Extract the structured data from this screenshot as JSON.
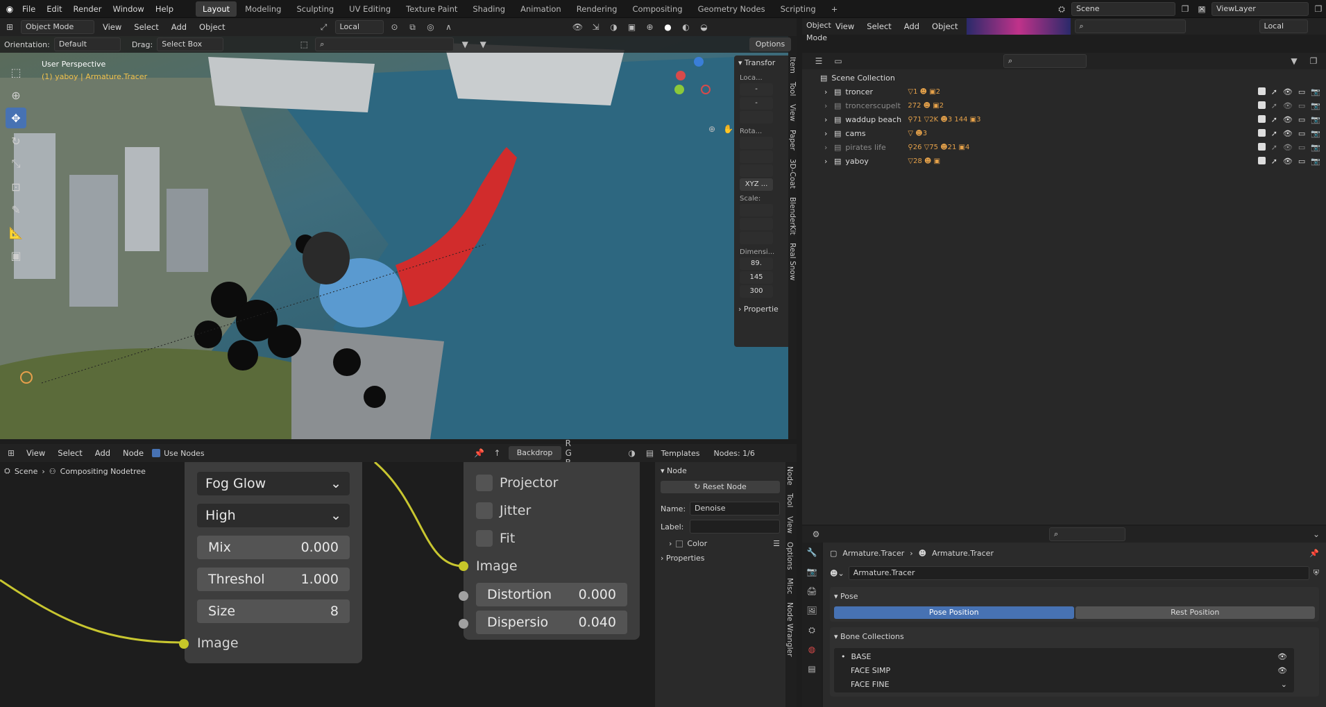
{
  "colors": {
    "accent": "#4772b3",
    "socket_image": "#c7c729",
    "socket_value": "#a1a1a1",
    "wire": "#c8c630"
  },
  "topbar": {
    "menus": [
      "File",
      "Edit",
      "Render",
      "Window",
      "Help"
    ],
    "workspaces": [
      "Layout",
      "Modeling",
      "Sculpting",
      "UV Editing",
      "Texture Paint",
      "Shading",
      "Animation",
      "Rendering",
      "Compositing",
      "Geometry Nodes",
      "Scripting"
    ],
    "active_workspace": "Layout",
    "scene": "Scene",
    "view_layer": "ViewLayer"
  },
  "viewport": {
    "mode": "Object Mode",
    "menus": [
      "View",
      "Select",
      "Add",
      "Object"
    ],
    "transform_space": "Local",
    "orientation_label": "Orientation:",
    "orientation_value": "Default",
    "drag_label": "Drag:",
    "drag_value": "Select Box",
    "options_label": "Options",
    "overlay_title": "User Perspective",
    "overlay_object": "(1) yaboy | Armature.Tracer",
    "npanel": {
      "header": "Transfor",
      "location_label": "Loca...",
      "location": [
        "-",
        "-",
        ""
      ],
      "rotation_label": "Rota...",
      "rotation_mode": "XYZ ...",
      "scale_label": "Scale:",
      "dimensions_label": "Dimensi...",
      "dimensions": [
        "89.",
        "145",
        "300"
      ],
      "properties_label": "Propertie",
      "tabs": [
        "Item",
        "Tool",
        "View",
        "Paper",
        "3D-Coat",
        "BlenderKit",
        "Real Snow"
      ]
    }
  },
  "outliner": {
    "mode": "Object Mode",
    "menus": [
      "View",
      "Select",
      "Add",
      "Object"
    ],
    "transform_space": "Local",
    "root": "Scene Collection",
    "items": [
      {
        "name": "troncer",
        "badges": "▽1 ☻ ▣2",
        "dim": false
      },
      {
        "name": "troncerscupelt",
        "badges": "272 ☻ ▣2",
        "dim": true
      },
      {
        "name": "waddup beach",
        "badges": "⚲71 ▽2K ☻3 144 ▣3",
        "dim": false
      },
      {
        "name": "cams",
        "badges": "▽ ☻3",
        "dim": false
      },
      {
        "name": "pirates life",
        "badges": "⚲26 ▽75 ☻21 ▣4",
        "dim": true
      },
      {
        "name": "yaboy",
        "badges": "▽28 ☻ ▣",
        "dim": false
      }
    ]
  },
  "node_editor": {
    "menus": [
      "View",
      "Select",
      "Add",
      "Node"
    ],
    "use_nodes": "Use Nodes",
    "backdrop": "Backdrop",
    "templates": "Templates",
    "nodes_count": "Nodes: 1/6",
    "breadcrumb_scene": "Scene",
    "breadcrumb_tree": "Compositing Nodetree",
    "glare": {
      "type": "Fog Glow",
      "quality": "High",
      "mix_label": "Mix",
      "mix": "0.000",
      "threshold_label": "Threshol",
      "threshold": "1.000",
      "size_label": "Size",
      "size": "8",
      "output": "Image"
    },
    "lens": {
      "projector": "Projector",
      "jitter": "Jitter",
      "fit": "Fit",
      "input": "Image",
      "distortion_label": "Distortion",
      "distortion": "0.000",
      "dispersion_label": "Dispersio",
      "dispersion": "0.040"
    },
    "sidebar": {
      "section": "Node",
      "reset": "Reset Node",
      "name_label": "Name:",
      "name": "Denoise",
      "label_label": "Label:",
      "label": "",
      "color": "Color",
      "properties": "Properties",
      "tabs": [
        "Node",
        "Tool",
        "View",
        "Options",
        "Misc",
        "Node Wrangler"
      ]
    }
  },
  "properties": {
    "breadcrumb_obj": "Armature.Tracer",
    "breadcrumb_data": "Armature.Tracer",
    "datablock": "Armature.Tracer",
    "pose_section": "Pose",
    "pose_position": "Pose Position",
    "rest_position": "Rest Position",
    "bone_collections": "Bone Collections",
    "bones": [
      "BASE",
      "FACE SIMP",
      "FACE FINE"
    ]
  }
}
